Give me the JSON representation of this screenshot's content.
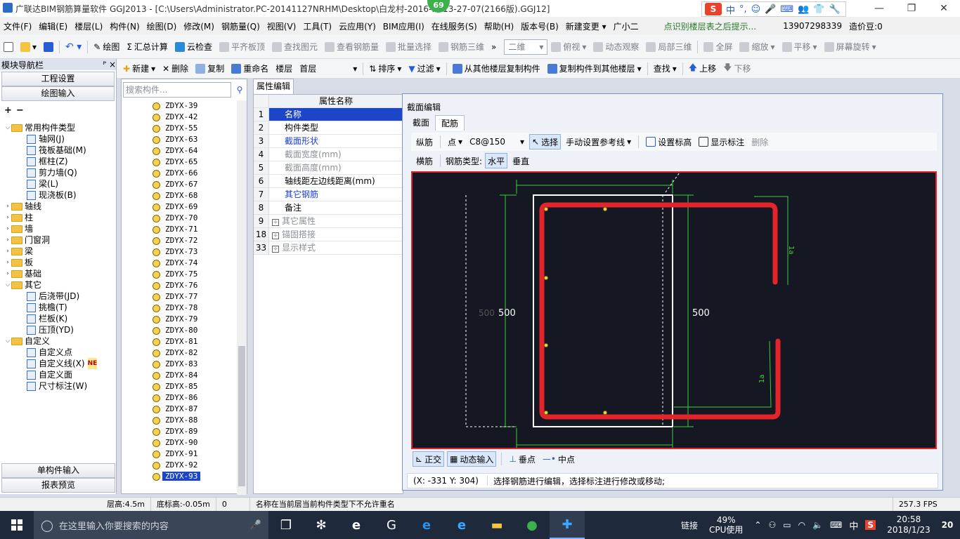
{
  "title": "广联达BIM钢筋算量软件 GGJ2013 - [C:\\Users\\Administrator.PC-20141127NRHM\\Desktop\\白龙村-2016-...-13-27-07(2166版).GGJ12]",
  "badge": "69",
  "ime": {
    "items": [
      "中",
      "°,",
      "☺",
      "🎤",
      "⌨",
      "👥",
      "👕",
      "🔧"
    ]
  },
  "menu": [
    "文件(F)",
    "编辑(E)",
    "楼层(L)",
    "构件(N)",
    "绘图(D)",
    "修改(M)",
    "钢筋量(Q)",
    "视图(V)",
    "工具(T)",
    "云应用(Y)",
    "BIM应用(I)",
    "在线服务(S)",
    "帮助(H)",
    "版本号(B)",
    "新建变更 ▾",
    "广小二"
  ],
  "menu_right": {
    "hint": "点识别楼层表之后提示...",
    "phone": "13907298339",
    "coins": "造价豆:0"
  },
  "toolbar1": {
    "items": [
      "绘图",
      "汇总计算",
      "云检查",
      "平齐板顶",
      "查找图元",
      "查看钢筋量",
      "批量选择",
      "钢筋三维",
      "二维",
      "俯视",
      "动态观察",
      "局部三维",
      "全屏",
      "缩放",
      "平移",
      "屏幕旋转"
    ]
  },
  "toolbar2": {
    "items": [
      "新建",
      "删除",
      "复制",
      "重命名",
      "楼层",
      "首层",
      "排序",
      "过滤",
      "从其他楼层复制构件",
      "复制构件到其他楼层",
      "查找",
      "上移",
      "下移"
    ]
  },
  "left_panel": {
    "header": "模块导航栏",
    "pin": "ᴾ",
    "close": "×",
    "top_buttons": [
      "工程设置",
      "绘图输入"
    ],
    "bottom_buttons": [
      "单构件输入",
      "报表预览"
    ],
    "tree": [
      {
        "label": "常用构件类型",
        "level": 0,
        "open": true
      },
      {
        "label": "轴网(J)",
        "level": 1
      },
      {
        "label": "筏板基础(M)",
        "level": 1
      },
      {
        "label": "框柱(Z)",
        "level": 1
      },
      {
        "label": "剪力墙(Q)",
        "level": 1
      },
      {
        "label": "梁(L)",
        "level": 1
      },
      {
        "label": "现浇板(B)",
        "level": 1
      },
      {
        "label": "轴线",
        "level": 0
      },
      {
        "label": "柱",
        "level": 0
      },
      {
        "label": "墙",
        "level": 0
      },
      {
        "label": "门窗洞",
        "level": 0
      },
      {
        "label": "梁",
        "level": 0
      },
      {
        "label": "板",
        "level": 0
      },
      {
        "label": "基础",
        "level": 0
      },
      {
        "label": "其它",
        "level": 0,
        "open": true
      },
      {
        "label": "后浇带(JD)",
        "level": 1
      },
      {
        "label": "挑檐(T)",
        "level": 1
      },
      {
        "label": "栏板(K)",
        "level": 1
      },
      {
        "label": "压顶(YD)",
        "level": 1
      },
      {
        "label": "自定义",
        "level": 0,
        "open": true
      },
      {
        "label": "自定义点",
        "level": 1
      },
      {
        "label": "自定义线(X)",
        "level": 1,
        "badge": "NE"
      },
      {
        "label": "自定义面",
        "level": 1
      },
      {
        "label": "尺寸标注(W)",
        "level": 1
      }
    ]
  },
  "list": {
    "search_placeholder": "搜索构件...",
    "items": [
      "ZDYX-39",
      "ZDYX-42",
      "ZDYX-55",
      "ZDYX-63",
      "ZDYX-64",
      "ZDYX-65",
      "ZDYX-66",
      "ZDYX-67",
      "ZDYX-68",
      "ZDYX-69",
      "ZDYX-70",
      "ZDYX-71",
      "ZDYX-72",
      "ZDYX-73",
      "ZDYX-74",
      "ZDYX-75",
      "ZDYX-76",
      "ZDYX-77",
      "ZDYX-78",
      "ZDYX-79",
      "ZDYX-80",
      "ZDYX-81",
      "ZDYX-82",
      "ZDYX-83",
      "ZDYX-84",
      "ZDYX-85",
      "ZDYX-86",
      "ZDYX-87",
      "ZDYX-88",
      "ZDYX-89",
      "ZDYX-90",
      "ZDYX-91",
      "ZDYX-92",
      "ZDYX-93"
    ],
    "selected": "ZDYX-93"
  },
  "props": {
    "tab": "属性编辑",
    "header": "属性名称",
    "rows": [
      {
        "n": "1",
        "v": "名称",
        "style": "sel"
      },
      {
        "n": "2",
        "v": "构件类型",
        "style": ""
      },
      {
        "n": "3",
        "v": "截面形状",
        "style": "blue"
      },
      {
        "n": "4",
        "v": "截面宽度(mm)",
        "style": "gray"
      },
      {
        "n": "5",
        "v": "截面高度(mm)",
        "style": "gray"
      },
      {
        "n": "6",
        "v": "轴线距左边线距离(mm)",
        "style": ""
      },
      {
        "n": "7",
        "v": "其它钢筋",
        "style": "blue"
      },
      {
        "n": "8",
        "v": "备注",
        "style": ""
      },
      {
        "n": "9",
        "v": "其它属性",
        "style": "gray",
        "plus": true
      },
      {
        "n": "18",
        "v": "锚固搭接",
        "style": "gray",
        "plus": true
      },
      {
        "n": "33",
        "v": "显示样式",
        "style": "gray",
        "plus": true
      }
    ]
  },
  "dialog": {
    "title": "截面编辑",
    "tabs": [
      "截面",
      "配筋"
    ],
    "toolbar1": {
      "zongjin": "纵筋",
      "point": "点",
      "spec": "C8@150",
      "select": "选择",
      "manual": "手动设置参考线",
      "height": "设置标高",
      "show_label": "显示标注",
      "delete": "删除"
    },
    "toolbar2": {
      "hengjin": "横筋",
      "type_label": "钢筋类型:",
      "horizontal": "水平",
      "vertical": "垂直"
    },
    "canvas": {
      "dim_500_left_dim": "500",
      "dim_500_left": "500",
      "dim_500_right": "500",
      "la_top": "1a",
      "la_bottom": "1a"
    },
    "bottom": {
      "ortho": "正交",
      "dynamic": "动态输入",
      "perp": "垂点",
      "mid": "中点"
    },
    "status": {
      "coords": "(X: -331 Y: 304)",
      "msg": "选择钢筋进行编辑，选择标注进行修改或移动;"
    }
  },
  "statusbar": {
    "floor_h": "层高:4.5m",
    "base_h": "底标高:-0.05m",
    "zero": "0",
    "msg": "名称在当前层当前构件类型下不允许重名",
    "fps": "257.3 FPS"
  },
  "taskbar": {
    "search": "在这里输入你要搜索的内容",
    "link": "链接",
    "cpu_pct": "49%",
    "cpu_label": "CPU使用",
    "lang": "中",
    "time": "20:58",
    "date": "2018/1/23",
    "notify": "20"
  },
  "colors": {
    "rebar": "#e3242b",
    "canvas_bg": "#151822",
    "dim": "#3bcf3b",
    "select_blue": "#1c46c7"
  }
}
